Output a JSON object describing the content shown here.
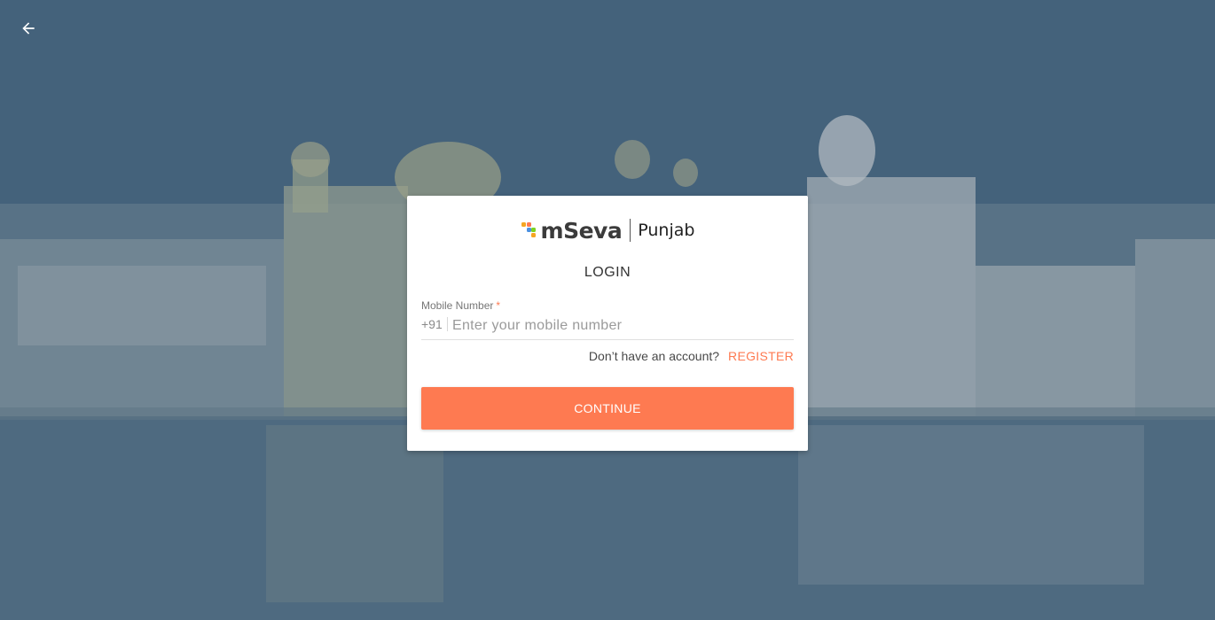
{
  "header": {
    "back_icon": "arrow-left-icon"
  },
  "card": {
    "logo": {
      "brand": "mSeva",
      "city": "Punjab",
      "dot_colors": [
        "#f5a623",
        "#fe7a51",
        "#4a90e2",
        "#7ed321",
        "#f5a623"
      ]
    },
    "title": "LOGIN",
    "mobile_field": {
      "label": "Mobile Number",
      "required_mark": "*",
      "prefix": "+91",
      "placeholder": "Enter your mobile number",
      "value": ""
    },
    "account_prompt": "Don’t have an account?",
    "register_label": "REGISTER",
    "continue_label": "CONTINUE"
  },
  "colors": {
    "accent": "#fe7a51",
    "overlay": "#3d5a73",
    "card_bg": "#ffffff"
  }
}
